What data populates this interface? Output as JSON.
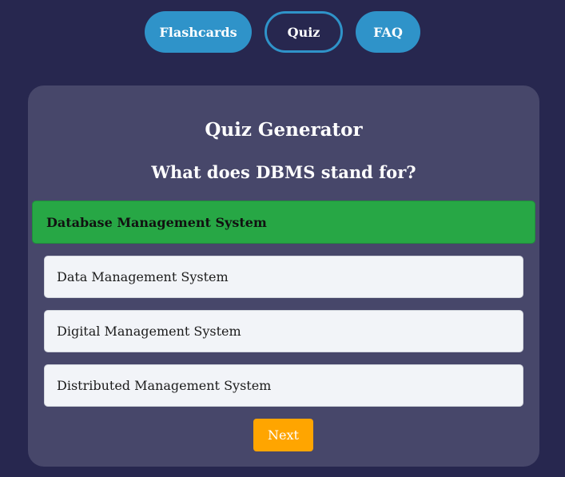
{
  "nav": {
    "items": [
      {
        "label": "Flashcards"
      },
      {
        "label": "Quiz"
      },
      {
        "label": "FAQ"
      }
    ]
  },
  "quiz": {
    "title": "Quiz Generator",
    "question": "What does DBMS stand for?",
    "options": [
      {
        "label": "Database Management System",
        "state": "correct"
      },
      {
        "label": "Data Management System"
      },
      {
        "label": "Digital Management System"
      },
      {
        "label": "Distributed Management System"
      }
    ],
    "next_label": "Next"
  },
  "colors": {
    "background": "#27274f",
    "card": "#47476a",
    "nav_accent": "#2f93c9",
    "correct": "#27a745",
    "next_button": "#ffa500"
  }
}
